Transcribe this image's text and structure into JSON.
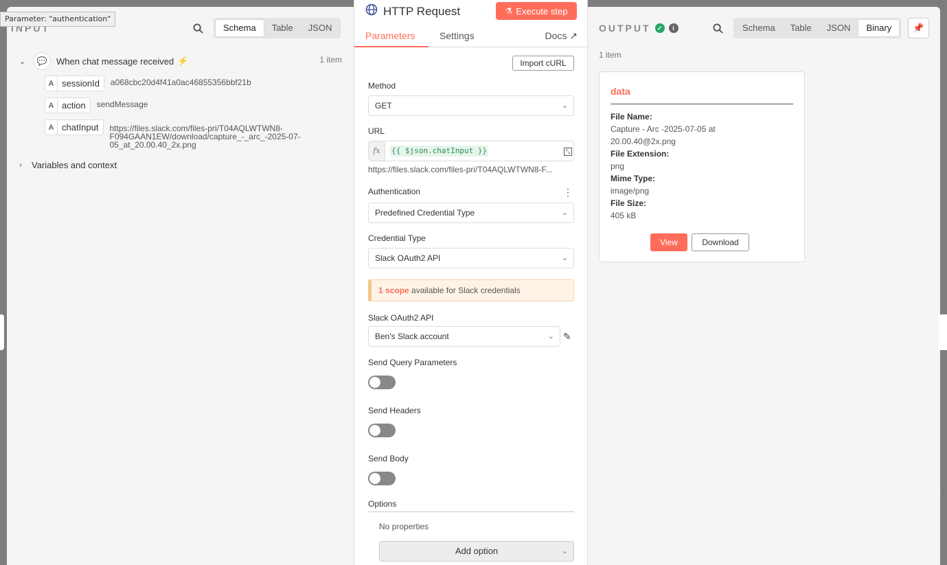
{
  "tooltip": "Parameter: \"authentication\"",
  "input": {
    "title": "INPUT",
    "views": [
      "Schema",
      "Table",
      "JSON"
    ],
    "active_view": "Schema",
    "node": {
      "name": "When chat message received",
      "count": "1 item"
    },
    "fields": [
      {
        "type": "A",
        "key": "sessionId",
        "value": "a068cbc20d4f41a0ac46855356bbf21b"
      },
      {
        "type": "A",
        "key": "action",
        "value": "sendMessage"
      },
      {
        "type": "A",
        "key": "chatInput",
        "value_lines": [
          "https://files.slack.com/files-pri/T04AQLWTWN8-",
          "F094GAAN1EW/download/capture_-_arc_-2025-07-",
          "05_at_20.00.40_2x.png"
        ]
      }
    ],
    "vars_label": "Variables and context"
  },
  "center": {
    "title": "HTTP Request",
    "execute_label": "Execute step",
    "tabs": [
      "Parameters",
      "Settings"
    ],
    "docs_label": "Docs",
    "import_label": "Import cURL",
    "method_label": "Method",
    "method_value": "GET",
    "url_label": "URL",
    "url_expr": "{{ $json.chatInput }}",
    "url_hint": "https://files.slack.com/files-pri/T04AQLWTWN8-F...",
    "auth_label": "Authentication",
    "auth_value": "Predefined Credential Type",
    "cred_type_label": "Credential Type",
    "cred_type_value": "Slack OAuth2 API",
    "notice_scope": "1 scope",
    "notice_rest": " available for Slack credentials",
    "slack_label": "Slack OAuth2 API",
    "slack_value": "Ben's Slack account",
    "query_label": "Send Query Parameters",
    "headers_label": "Send Headers",
    "body_label": "Send Body",
    "options_label": "Options",
    "no_props": "No properties",
    "add_option": "Add option"
  },
  "output": {
    "title": "OUTPUT",
    "views": [
      "Schema",
      "Table",
      "JSON",
      "Binary"
    ],
    "active_view": "Binary",
    "count": "1 item",
    "card": {
      "title": "data",
      "file_name_label": "File Name:",
      "file_name_lines": [
        "Capture - Arc -2025-07-05 at",
        "20.00.40@2x.png"
      ],
      "ext_label": "File Extension:",
      "ext_value": "png",
      "mime_label": "Mime Type:",
      "mime_value": "image/png",
      "size_label": "File Size:",
      "size_value": "405 kB",
      "view_label": "View",
      "download_label": "Download"
    }
  },
  "colors": {
    "accent": "#ff6d5a",
    "success": "#29a568",
    "brand_globe": "#3b4a99"
  }
}
